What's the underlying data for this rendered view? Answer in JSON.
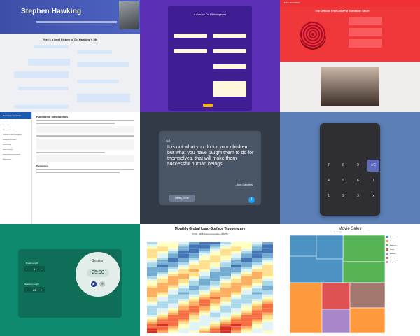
{
  "tiles": {
    "hawking": {
      "title": "Stephen Hawking",
      "section": "Here's a brief history of Dr. Hawking's life"
    },
    "survey": {
      "title": "A Survey On Philosophers",
      "submit": "Submit"
    },
    "turntable": {
      "brand": "Fake Turntables",
      "heading": "The Official FreeCodeFM Turntable Store"
    },
    "docs": {
      "sidebar_title": "Dart documentation",
      "sidebar_items": [
        "Functions: introduction",
        "Parameters",
        "The main() function",
        "Functions as first-class objects",
        "Anonymous functions",
        "Lexical scope",
        "Lexical closures",
        "Testing functions for equality",
        "Return values"
      ],
      "heading": "Functions: introduction",
      "section": "Parameters"
    },
    "quote": {
      "text": "It is not what you do for your children, but what you have taught them to do for themselves, that will make them successful human beings.",
      "author": "- Ann Landers",
      "button": "New Quote"
    },
    "calculator": {
      "keys": [
        "AC",
        "7",
        "8",
        "9",
        "/",
        "4",
        "5",
        "6",
        "x",
        "1",
        "2",
        "3",
        "-",
        "0",
        ".",
        "=",
        "+"
      ]
    },
    "pomodoro": {
      "break_label": "Break Length",
      "break_value": "5",
      "session_label": "Session Length",
      "session_value": "25",
      "session_title": "Session",
      "time": "25:00",
      "minus": "−",
      "plus": "+"
    },
    "heatmap": {
      "title": "Monthly Global Land-Surface Temperature",
      "subtitle": "1753 - 2015: base temperature 8.66℃"
    },
    "movies": {
      "title": "Movie Sales",
      "subtitle": "Top 100 Highest Grossing Movies Grouped By Genre",
      "legend": [
        "Action",
        "Drama",
        "Adventure",
        "Family",
        "Animation",
        "Comedy",
        "Biography"
      ]
    }
  },
  "colors": {
    "heat": [
      "#4575b4",
      "#74add1",
      "#abd9e9",
      "#e0f3f8",
      "#ffffbf",
      "#fee090",
      "#fdae61",
      "#f46d43",
      "#d73027"
    ],
    "movie": [
      "#4c92c3",
      "#ff993e",
      "#56b356",
      "#de5253",
      "#a985ca",
      "#a3786f",
      "#e88ac6"
    ]
  }
}
